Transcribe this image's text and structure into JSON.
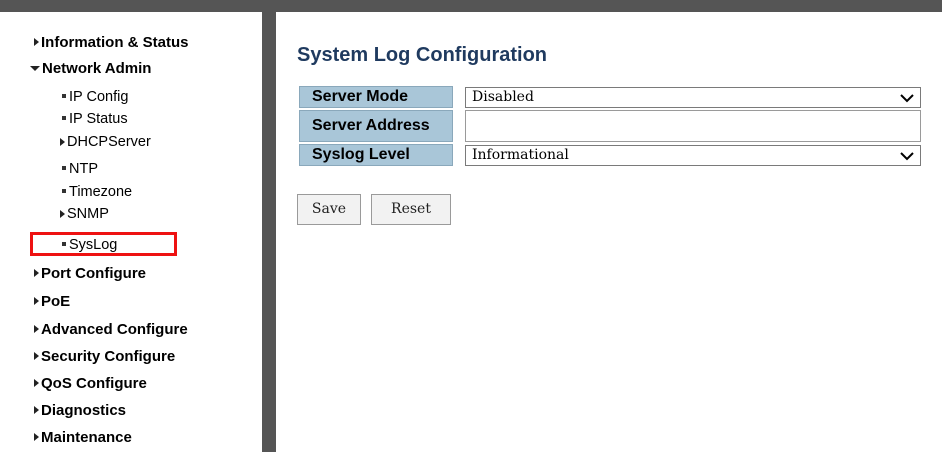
{
  "sidebar": {
    "information_status": "Information & Status",
    "network_admin": "Network Admin",
    "ip_config": "IP Config",
    "ip_status": "IP Status",
    "dhcp_server": "DHCPServer",
    "ntp": "NTP",
    "timezone": "Timezone",
    "snmp": "SNMP",
    "syslog": "SysLog",
    "port_configure": "Port Configure",
    "poe": "PoE",
    "advanced_configure": "Advanced Configure",
    "security_configure": "Security Configure",
    "qos_configure": "QoS Configure",
    "diagnostics": "Diagnostics",
    "maintenance": "Maintenance"
  },
  "main": {
    "title": "System Log Configuration",
    "server_mode_label": "Server Mode",
    "server_mode_value": "Disabled",
    "server_address_label": "Server Address",
    "server_address_value": "",
    "syslog_level_label": "Syslog Level",
    "syslog_level_value": "Informational",
    "save_label": "Save",
    "reset_label": "Reset"
  },
  "colors": {
    "label_bg": "#a9c6d8",
    "highlight": "#ee1111",
    "title": "#1f3a5f"
  }
}
